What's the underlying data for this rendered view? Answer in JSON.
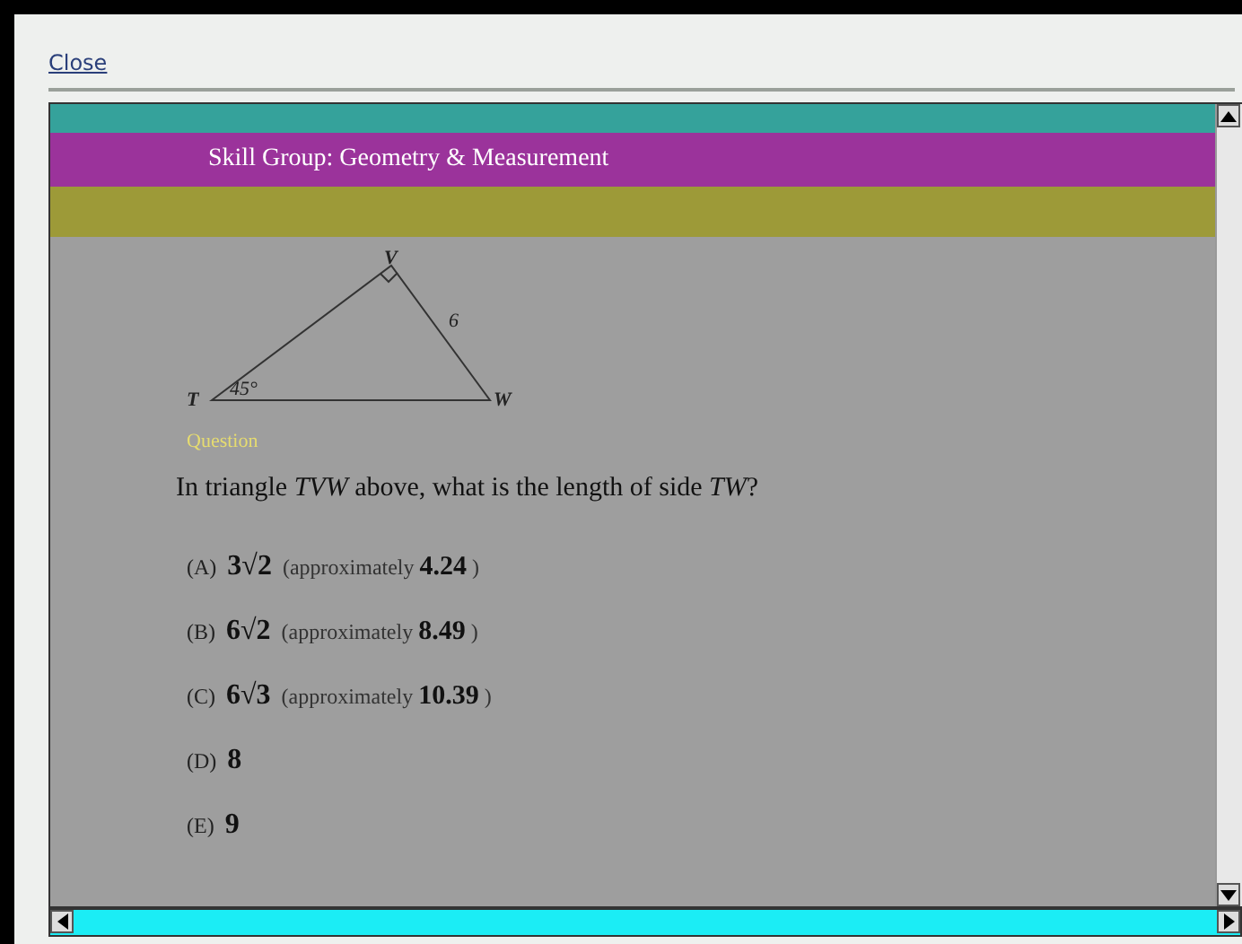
{
  "close_link": "Close",
  "header": {
    "title": "Skill Group: Geometry & Measurement"
  },
  "figure": {
    "labels": [
      {
        "kind": "vertex",
        "text": "V"
      },
      {
        "kind": "vertex",
        "text": "T"
      },
      {
        "kind": "vertex",
        "text": "W"
      },
      {
        "kind": "side",
        "text": "6"
      },
      {
        "kind": "angle",
        "text": "45°"
      }
    ]
  },
  "question_label": "Question",
  "question": "In triangle *TVW* above, what is the length of side *TW*?",
  "options": [
    {
      "letter": "(A)",
      "value": "3√2",
      "note": "(approximately",
      "approx": "4.24",
      "close": ")"
    },
    {
      "letter": "(B)",
      "value": "6√2",
      "note": "(approximately",
      "approx": "8.49",
      "close": ")"
    },
    {
      "letter": "(C)",
      "value": "6√3",
      "note": "(approximately",
      "approx": "10.39",
      "close": ")"
    },
    {
      "letter": "(D)",
      "value": "8"
    },
    {
      "letter": "(E)",
      "value": "9"
    }
  ]
}
